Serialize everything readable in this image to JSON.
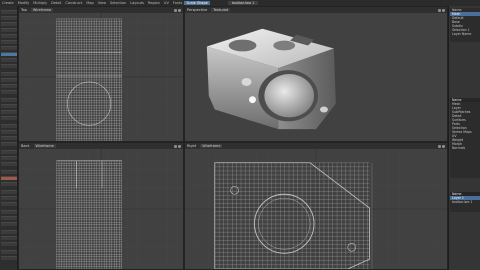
{
  "menubar": {
    "items": [
      "Create",
      "Modify",
      "Multiply",
      "Detail",
      "Construct",
      "Map",
      "View",
      "Selection",
      "Layouts",
      "Region",
      "UV",
      "Fonts",
      "Scale Shape"
    ],
    "doc_tab": "toolbar.lwo 1"
  },
  "viewports": {
    "top_left": {
      "label": "Top",
      "mode": "Wireframe"
    },
    "top_right": {
      "label": "Perspective",
      "mode": "Textured"
    },
    "bottom_left": {
      "label": "Back",
      "mode": "Wireframe"
    },
    "bottom_right": {
      "label": "Right",
      "mode": "Wireframe"
    }
  },
  "right_panel": {
    "properties": [
      "Name",
      "Mesh",
      "Default",
      "Base",
      "Subdiv",
      "Selection 1",
      "Layer Name"
    ],
    "items_header": "Name",
    "items": [
      "Mesh",
      "Layer",
      "SubPatches",
      "Detail",
      "Surfaces",
      "Parts",
      "Selection",
      "Vertex Maps",
      "UV",
      "Weight",
      "Morph",
      "Normals"
    ],
    "lower_header": "Name",
    "lower_items": [
      "Layer 1",
      "toolbar.lwo 1"
    ]
  },
  "colors": {
    "background": "#3a3a3a",
    "viewport": "#414141",
    "wire": "#c4c4c4",
    "selection": "#4b78a6",
    "accent": "#a05a4c"
  }
}
